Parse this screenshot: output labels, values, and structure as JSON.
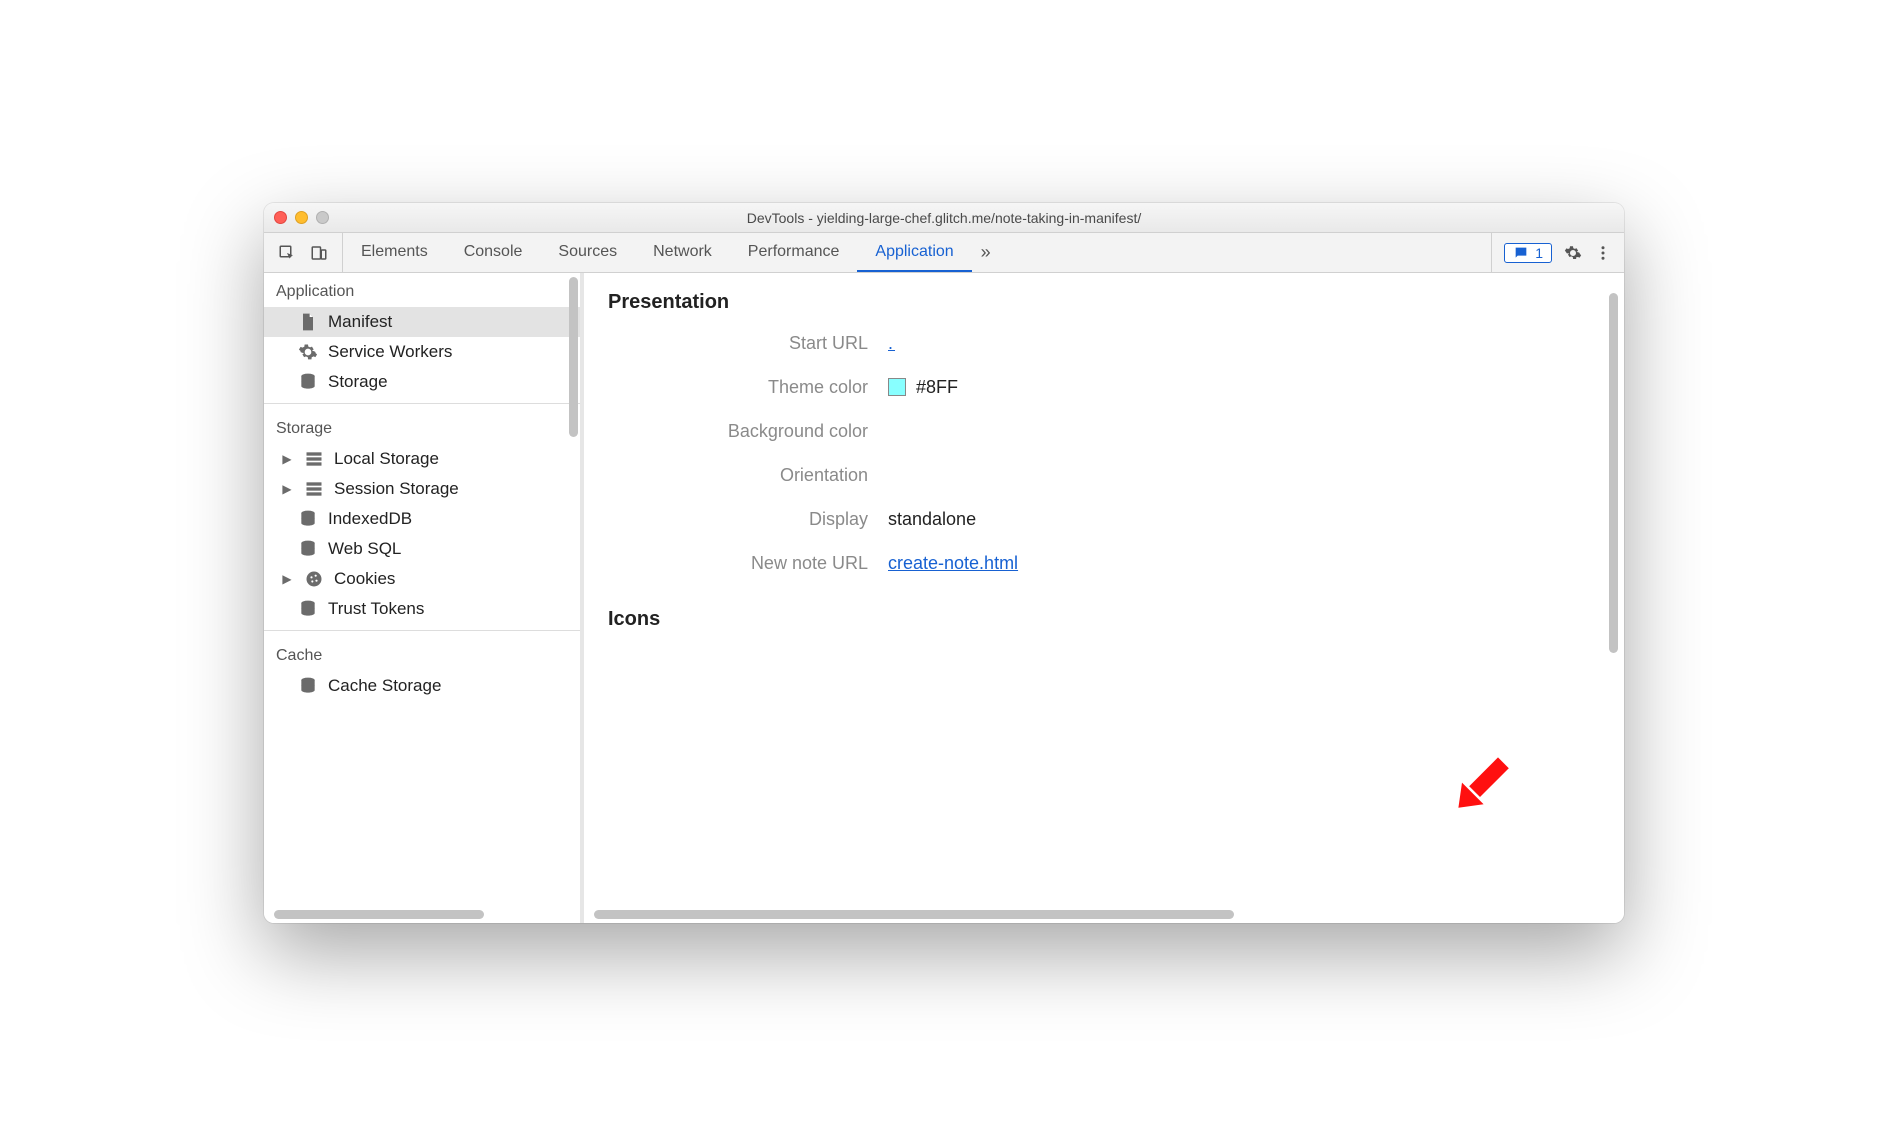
{
  "window": {
    "title": "DevTools - yielding-large-chef.glitch.me/note-taking-in-manifest/"
  },
  "tabs": {
    "elements": "Elements",
    "console": "Console",
    "sources": "Sources",
    "network": "Network",
    "performance": "Performance",
    "application": "Application"
  },
  "toolbar": {
    "message_count": "1"
  },
  "sidebar": {
    "application": {
      "heading": "Application",
      "manifest": "Manifest",
      "service_workers": "Service Workers",
      "storage": "Storage"
    },
    "storage": {
      "heading": "Storage",
      "local_storage": "Local Storage",
      "session_storage": "Session Storage",
      "indexeddb": "IndexedDB",
      "web_sql": "Web SQL",
      "cookies": "Cookies",
      "trust_tokens": "Trust Tokens"
    },
    "cache": {
      "heading": "Cache",
      "cache_storage": "Cache Storage"
    }
  },
  "panel": {
    "presentation_heading": "Presentation",
    "icons_heading": "Icons",
    "labels": {
      "start_url": "Start URL",
      "theme_color": "Theme color",
      "background_color": "Background color",
      "orientation": "Orientation",
      "display": "Display",
      "new_note_url": "New note URL"
    },
    "values": {
      "start_url": ".",
      "theme_color": "#8FF",
      "theme_color_swatch": "#88ffff",
      "background_color": "",
      "orientation": "",
      "display": "standalone",
      "new_note_url": "create-note.html"
    }
  }
}
